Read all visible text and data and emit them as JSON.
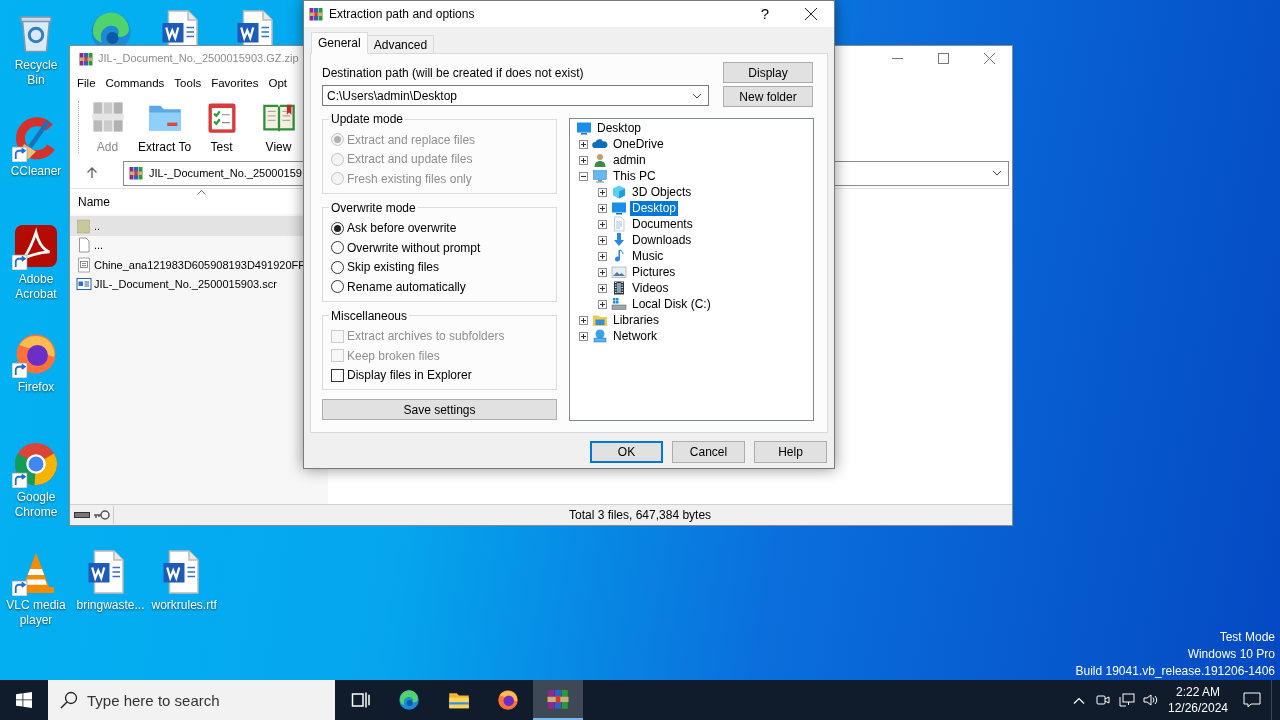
{
  "desktop_icons": [
    {
      "kind": "recycle",
      "label": "Recycle Bin",
      "shortcut": false
    },
    {
      "kind": "edge",
      "shortcut": false
    },
    {
      "kind": "word",
      "shortcut": false
    },
    {
      "kind": "word",
      "shortcut": false
    },
    {
      "kind": "ccleaner",
      "label": "CCleaner",
      "shortcut": true
    },
    {
      "kind": "acrobat",
      "label": "Adobe Acrobat",
      "shortcut": true
    },
    {
      "kind": "firefox",
      "label": "Firefox",
      "shortcut": true
    },
    {
      "kind": "chrome",
      "label": "Google Chrome",
      "shortcut": true
    },
    {
      "kind": "vlc",
      "label": "VLC media player",
      "shortcut": true
    },
    {
      "kind": "word",
      "label": "bringwaste...",
      "shortcut": false
    },
    {
      "kind": "word",
      "label": "workrules.rtf",
      "shortcut": false
    }
  ],
  "archive_window": {
    "title": "JIL-_Document_No._2500015903.GZ.zip",
    "menu": [
      "File",
      "Commands",
      "Tools",
      "Favorites",
      "Opt"
    ],
    "toolbar": [
      {
        "kind": "add",
        "label": "Add",
        "disabled": true
      },
      {
        "kind": "extract",
        "label": "Extract To",
        "disabled": false
      },
      {
        "kind": "test",
        "label": "Test",
        "disabled": false
      },
      {
        "kind": "view",
        "label": "View",
        "disabled": false
      }
    ],
    "path": "JIL-_Document_No._25000159",
    "columns": [
      "Name"
    ],
    "files": [
      {
        "kind": "parent",
        "name": "..",
        "selected": true
      },
      {
        "kind": "blank",
        "name": "...",
        "selected": false
      },
      {
        "kind": "text",
        "name": "Chine_ana121983D605908193D491920FF",
        "selected": false
      },
      {
        "kind": "program",
        "name": "JIL-_Document_No._2500015903.scr",
        "selected": false
      }
    ],
    "status": "Total 3 files, 647,384 bytes"
  },
  "dialog": {
    "title": "Extraction path and options",
    "help": "?",
    "tabs": [
      {
        "label": "General",
        "selected": true
      },
      {
        "label": "Advanced",
        "selected": false
      }
    ],
    "destination_label": "Destination path (will be created if does not exist)",
    "destination_value": "C:\\Users\\admin\\Desktop",
    "side_buttons": [
      "Display",
      "New folder"
    ],
    "groups": [
      {
        "title": "Update mode",
        "kind": "radio",
        "options": [
          {
            "label": "Extract and replace files",
            "selected": true,
            "disabled": true
          },
          {
            "label": "Extract and update files",
            "selected": false,
            "disabled": true
          },
          {
            "label": "Fresh existing files only",
            "selected": false,
            "disabled": true
          }
        ]
      },
      {
        "title": "Overwrite mode",
        "kind": "radio",
        "options": [
          {
            "label": "Ask before overwrite",
            "selected": true,
            "disabled": false
          },
          {
            "label": "Overwrite without prompt",
            "selected": false,
            "disabled": false
          },
          {
            "label": "Skip existing files",
            "selected": false,
            "disabled": false
          },
          {
            "label": "Rename automatically",
            "selected": false,
            "disabled": false
          }
        ]
      },
      {
        "title": "Miscellaneous",
        "kind": "check",
        "options": [
          {
            "label": "Extract archives to subfolders",
            "checked": false,
            "disabled": true
          },
          {
            "label": "Keep broken files",
            "checked": false,
            "disabled": true
          },
          {
            "label": "Display files in Explorer",
            "checked": false,
            "disabled": false
          }
        ]
      }
    ],
    "save_button": "Save settings",
    "tree": [
      {
        "kind": "desktop",
        "label": "Desktop",
        "selected": false,
        "children": [
          {
            "kind": "onedrive",
            "label": "OneDrive",
            "expanded": false,
            "selected": false
          },
          {
            "kind": "user",
            "label": "admin",
            "expanded": false,
            "selected": false
          },
          {
            "kind": "pc",
            "label": "This PC",
            "expanded": true,
            "selected": false,
            "children": [
              {
                "kind": "cube",
                "label": "3D Objects",
                "expanded": false,
                "selected": false
              },
              {
                "kind": "desktop",
                "label": "Desktop",
                "expanded": false,
                "selected": true
              },
              {
                "kind": "documents",
                "label": "Documents",
                "expanded": false,
                "selected": false
              },
              {
                "kind": "downloads",
                "label": "Downloads",
                "expanded": false,
                "selected": false
              },
              {
                "kind": "music",
                "label": "Music",
                "expanded": false,
                "selected": false
              },
              {
                "kind": "pictures",
                "label": "Pictures",
                "expanded": false,
                "selected": false
              },
              {
                "kind": "videos",
                "label": "Videos",
                "expanded": false,
                "selected": false
              },
              {
                "kind": "disk",
                "label": "Local Disk (C:)",
                "expanded": false,
                "selected": false
              }
            ]
          },
          {
            "kind": "libraries",
            "label": "Libraries",
            "expanded": false,
            "selected": false
          },
          {
            "kind": "network",
            "label": "Network",
            "expanded": false,
            "selected": false
          }
        ]
      }
    ],
    "buttons": [
      {
        "label": "OK",
        "default": true
      },
      {
        "label": "Cancel",
        "default": false
      },
      {
        "label": "Help",
        "default": false
      }
    ]
  },
  "taskbar": {
    "search_placeholder": "Type here to search",
    "apps": [
      {
        "kind": "taskview",
        "active": false
      },
      {
        "kind": "edge",
        "active": false
      },
      {
        "kind": "explorer",
        "active": false
      },
      {
        "kind": "firefox",
        "active": false
      },
      {
        "kind": "archive",
        "active": true
      }
    ],
    "time": "2:22 AM",
    "date": "12/26/2024"
  },
  "desktop_notice": [
    "Test Mode",
    "Windows 10 Pro",
    "Build 19041.vb_release.191206-1406"
  ]
}
